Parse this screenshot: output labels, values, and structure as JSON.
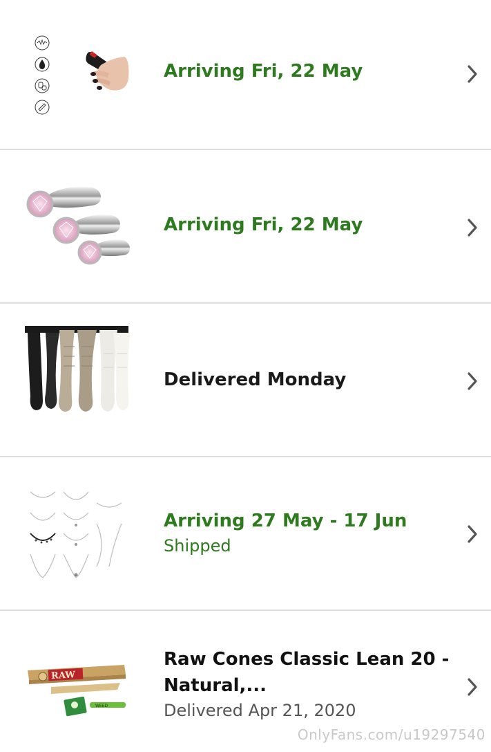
{
  "orders": [
    {
      "status": "Arriving Fri, 22 May",
      "thumb_icon": "vibrator-product-image"
    },
    {
      "status": "Arriving Fri, 22 May",
      "thumb_icon": "plug-set-product-image"
    },
    {
      "status": "Delivered Monday",
      "thumb_icon": "thigh-high-socks-product-image"
    },
    {
      "status": "Arriving 27 May - 17 Jun",
      "substatus": "Shipped",
      "thumb_icon": "necklace-set-product-image"
    },
    {
      "title_line1": "Raw Cones Classic Lean 20 -",
      "title_line2": "Natural,...",
      "substatus": "Delivered Apr 21, 2020",
      "thumb_icon": "raw-cones-product-image"
    }
  ],
  "colors": {
    "green": "#2d7a1f",
    "divider": "#dddddd",
    "chevron": "#555555"
  },
  "icons": {
    "chevron": "chevron-right-icon"
  },
  "watermark": "OnlyFans.com/u19297540"
}
